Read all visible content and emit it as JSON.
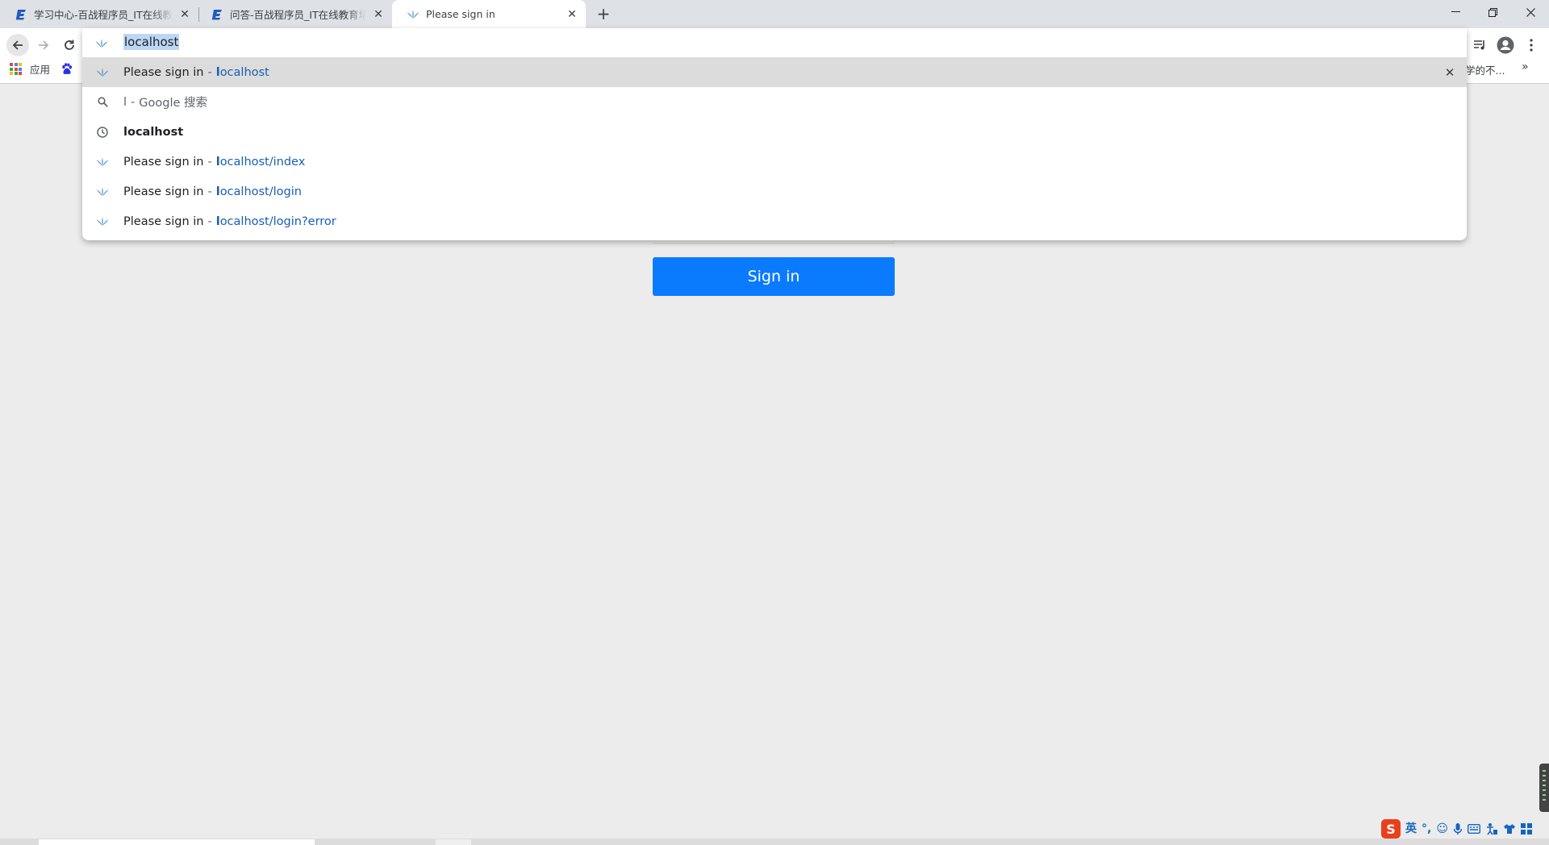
{
  "browser": {
    "tabs": [
      {
        "title": "学习中心-百战程序员_IT在线教育",
        "favicon": "bz-icon"
      },
      {
        "title": "问答-百战程序员_IT在线教育培训",
        "favicon": "bz-icon"
      },
      {
        "title": "Please sign in",
        "favicon": "spring-icon",
        "active": true
      }
    ],
    "bookmarks": {
      "apps_label": "应用",
      "overflow_label": "学的不..."
    }
  },
  "omnibox": {
    "input_text": "localhost",
    "suggestions": [
      {
        "type": "page",
        "title": "Please sign in",
        "separator": "-",
        "url_bold": "l",
        "url_rest": "ocalhost",
        "selected": true
      },
      {
        "type": "search",
        "query": "l",
        "separator": "-",
        "engine": "Google 搜索"
      },
      {
        "type": "history",
        "bold": "l",
        "rest": "ocalhost"
      },
      {
        "type": "page",
        "title": "Please sign in",
        "separator": "-",
        "url_bold": "l",
        "url_rest": "ocalhost/index"
      },
      {
        "type": "page",
        "title": "Please sign in",
        "separator": "-",
        "url_bold": "l",
        "url_rest": "ocalhost/login"
      },
      {
        "type": "page",
        "title": "Please sign in",
        "separator": "-",
        "url_bold": "l",
        "url_rest": "ocalhost/login?error"
      }
    ]
  },
  "page": {
    "signin_button": "Sign in"
  },
  "ime": {
    "logo": "S",
    "mode": "英"
  },
  "colors": {
    "primary": "#0a7bff",
    "link": "#1a5eb6",
    "tabstrip": "#dee1e6",
    "page_bg": "#ececec"
  }
}
